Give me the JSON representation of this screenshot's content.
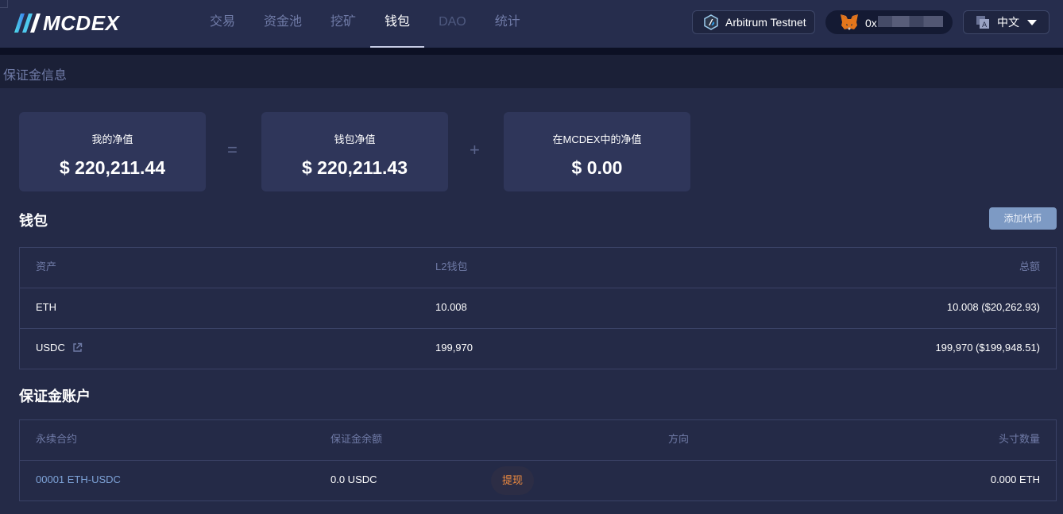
{
  "header": {
    "logo_text": "MCDEX",
    "nav": [
      {
        "label": "交易"
      },
      {
        "label": "资金池"
      },
      {
        "label": "挖矿"
      },
      {
        "label": "钱包"
      },
      {
        "label": "DAO"
      },
      {
        "label": "统计"
      }
    ],
    "active_nav": "钱包",
    "network_label": "Arbitrum Testnet",
    "wallet_address_prefix": "0x",
    "language_label": "中文"
  },
  "subheader": {
    "title": "保证金信息"
  },
  "summary": {
    "my_net_value": {
      "label": "我的净值",
      "value": "$ 220,211.44"
    },
    "equals_symbol": "=",
    "wallet_net_value": {
      "label": "钱包净值",
      "value": "$ 220,211.43"
    },
    "plus_symbol": "+",
    "mcdex_net_value": {
      "label": "在MCDEX中的净值",
      "value": "$ 0.00"
    }
  },
  "wallet": {
    "title": "钱包",
    "add_token_label": "添加代币",
    "columns": [
      "资产",
      "L2钱包",
      "总额"
    ],
    "rows": [
      {
        "asset": "ETH",
        "l2_wallet": "10.008",
        "total": "10.008 ($20,262.93)"
      },
      {
        "asset": "USDC",
        "l2_wallet": "199,970",
        "total": "199,970 ($199,948.51)"
      }
    ]
  },
  "margin_account": {
    "title": "保证金账户",
    "columns": [
      "永续合约",
      "保证金余额",
      "方向",
      "头寸数量"
    ],
    "rows": [
      {
        "perpetual": "00001 ETH-USDC",
        "margin_balance": "0.0 USDC",
        "withdraw_label": "提现",
        "direction": "",
        "position": "0.000 ETH"
      }
    ]
  },
  "colors": {
    "background": "#242a47",
    "card": "#2f365a",
    "accent_link": "#7ea3d8",
    "withdraw_text": "#ef8b40",
    "add_button": "#7d9ac4"
  },
  "icons": [
    "logo-icon",
    "arbitrum-icon",
    "metamask-fox-icon",
    "language-icon",
    "caret-down-icon",
    "external-link-icon"
  ]
}
